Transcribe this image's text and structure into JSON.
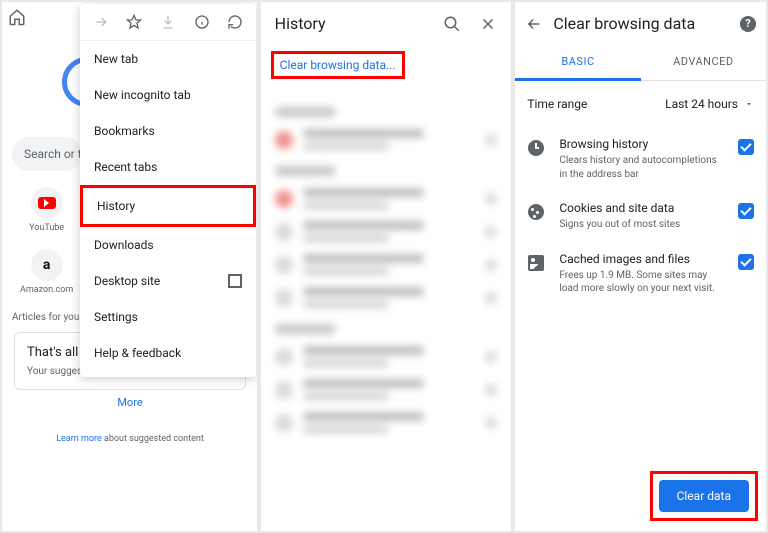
{
  "panel1": {
    "search_placeholder": "Search or ty",
    "shortcuts": [
      {
        "label": "YouTube"
      },
      {
        "label": "Amazon.com"
      }
    ],
    "articles_label": "Articles for you",
    "articles_title": "That's all for now",
    "articles_sub": "Your suggested articles appear here",
    "more": "More",
    "learn_more": "Learn more",
    "learn_suffix": " about suggested content"
  },
  "menu": {
    "items": [
      "New tab",
      "New incognito tab",
      "Bookmarks",
      "Recent tabs",
      "History",
      "Downloads",
      "Desktop site",
      "Settings",
      "Help & feedback"
    ]
  },
  "panel2": {
    "title": "History",
    "clear_link": "Clear browsing data..."
  },
  "panel3": {
    "title": "Clear browsing data",
    "tab_basic": "BASIC",
    "tab_advanced": "ADVANCED",
    "time_label": "Time range",
    "time_value": "Last 24 hours",
    "options": [
      {
        "title": "Browsing history",
        "sub": "Clears history and autocompletions in the address bar"
      },
      {
        "title": "Cookies and site data",
        "sub": "Signs you out of most sites"
      },
      {
        "title": "Cached images and files",
        "sub": "Frees up 1.9 MB. Some sites may load more slowly on your next visit."
      }
    ],
    "clear_button": "Clear data"
  }
}
